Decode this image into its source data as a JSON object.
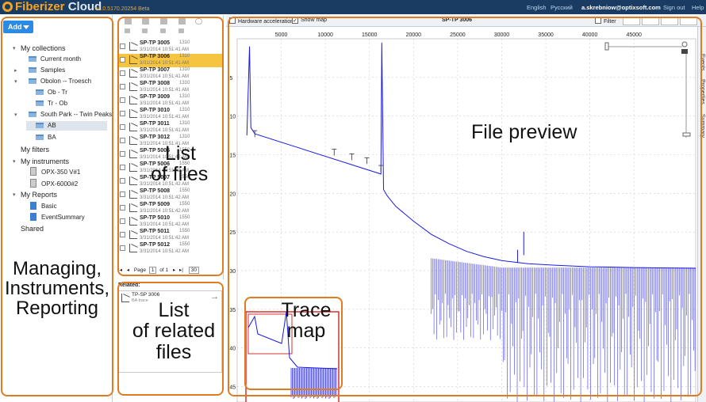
{
  "app": {
    "logo_text_1": "Fiberizer",
    "logo_text_2": "Cloud",
    "version": "v1.0.5170.20254 Beta",
    "lang_en": "English",
    "lang_ru": "Русский",
    "user": "a.skrebniow@optixsoft.com",
    "signout": "Sign out",
    "help": "Help"
  },
  "sidebar": {
    "add_label": "Add",
    "my_collections": "My collections",
    "current_month": "Current month",
    "samples": "Samples",
    "obolon": "Obolon -- Troesch",
    "ob_tr": "Ob - Tr",
    "tr_ob": "Tr - Ob",
    "south_park": "South Park -- Twin Peaks",
    "ab": "AB",
    "ba": "BA",
    "my_filters": "My filters",
    "my_instruments": "My instruments",
    "instr1": "OPX-350 V#1",
    "instr2": "OPX-6000#2",
    "my_reports": "My Reports",
    "basic": "Basic",
    "event_summary": "EventSummary",
    "shared": "Shared"
  },
  "files": [
    {
      "name": "SP-TP 3005",
      "wl": "1310",
      "date": "3/31/2014 10:51:41 AM"
    },
    {
      "name": "SP-TP 3006",
      "wl": "1310",
      "date": "3/31/2014 10:51:41 AM"
    },
    {
      "name": "SP-TP 3007",
      "wl": "1310",
      "date": "3/31/2014 10:51:41 AM"
    },
    {
      "name": "SP-TP 3008",
      "wl": "1310",
      "date": "3/31/2014 10:51:41 AM"
    },
    {
      "name": "SP-TP 3009",
      "wl": "1310",
      "date": "3/31/2014 10:51:41 AM"
    },
    {
      "name": "SP-TP 3010",
      "wl": "1310",
      "date": "3/31/2014 10:51:41 AM"
    },
    {
      "name": "SP-TP 3011",
      "wl": "1310",
      "date": "3/31/2014 10:51:41 AM"
    },
    {
      "name": "SP-TP 3012",
      "wl": "1310",
      "date": "3/31/2014 10:51:41 AM"
    },
    {
      "name": "SP-TP 5005",
      "wl": "1550",
      "date": "3/31/2014 10:51:42 AM"
    },
    {
      "name": "SP-TP 5006",
      "wl": "1550",
      "date": "3/31/2014 10:51:42 AM"
    },
    {
      "name": "SP-TP 5007",
      "wl": "1550",
      "date": "3/31/2014 10:51:42 AM"
    },
    {
      "name": "SP-TP 5008",
      "wl": "1550",
      "date": "3/31/2014 10:51:42 AM"
    },
    {
      "name": "SP-TP 5009",
      "wl": "1550",
      "date": "3/31/2014 10:51:42 AM"
    },
    {
      "name": "SP-TP 5010",
      "wl": "1550",
      "date": "3/31/2014 10:51:42 AM"
    },
    {
      "name": "SP-TP 5011",
      "wl": "1550",
      "date": "3/31/2014 10:51:42 AM"
    },
    {
      "name": "SP-TP 5012",
      "wl": "1550",
      "date": "3/31/2014 10:51:42 AM"
    }
  ],
  "pager": {
    "page_label": "Page",
    "page": "1",
    "of_label": "of 1",
    "page_size": "30"
  },
  "related": {
    "label": "Related:",
    "item_name": "TP-SP 3006",
    "item_sub": "BA trace"
  },
  "main": {
    "hw_accel": "Hardware acceleration",
    "show_map": "Show map",
    "title": "SP-TP 3006",
    "filter": "Filter",
    "tab_events": "Events",
    "tab_properties": "Properties",
    "tab_summary": "Summary"
  },
  "chart_data": {
    "type": "line",
    "x_ticks": [
      "5000",
      "10000",
      "15000",
      "20000",
      "25000",
      "30000",
      "35000",
      "40000",
      "45000"
    ],
    "y_ticks": [
      "-5",
      "-10",
      "-15",
      "-20",
      "-25",
      "-30",
      "-35",
      "-40",
      "-45"
    ],
    "xlim": [
      0,
      52000
    ],
    "ylim": [
      -47,
      0
    ]
  },
  "annotations": {
    "managing_1": "Managing,",
    "managing_2": "Instruments,",
    "managing_3": "Reporting",
    "list_1": "List",
    "list_2": "of files",
    "rel_1": "List",
    "rel_2": "of related",
    "rel_3": "files",
    "preview": "File preview",
    "trace_1": "Trace",
    "trace_2": "map"
  },
  "colors": {
    "trace": "#1a1ae6",
    "annotation_border": "#e07b22",
    "selected_row": "#f5c542",
    "topbar": "#1a3c63"
  }
}
